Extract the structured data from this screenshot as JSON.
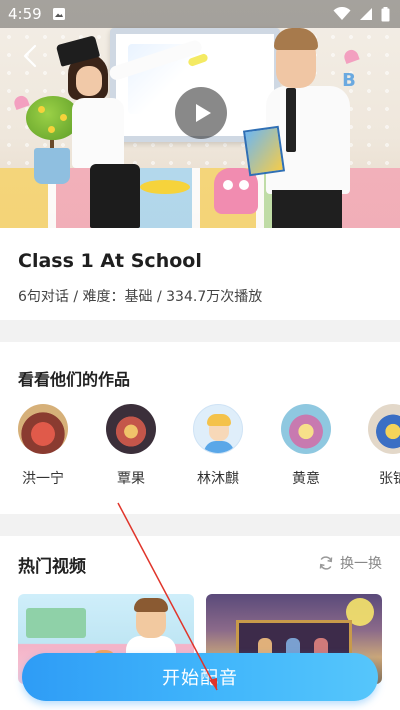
{
  "status_bar": {
    "time": "4:59"
  },
  "video": {
    "letter_b": "B"
  },
  "lesson": {
    "title": "Class 1 At School",
    "meta": "6句对话 / 难度：基础 / 334.7万次播放"
  },
  "works": {
    "heading": "看看他们的作品",
    "items": [
      {
        "name": "洪一宁"
      },
      {
        "name": "覃果"
      },
      {
        "name": "林沐麒"
      },
      {
        "name": "黄意"
      },
      {
        "name": "张锦"
      }
    ]
  },
  "hot_videos": {
    "heading": "热门视频",
    "refresh_label": "换一换"
  },
  "cta": {
    "label": "开始配音"
  },
  "colors": {
    "accent_blue": "#2e9cf6",
    "annotation_red": "#e0352b"
  }
}
